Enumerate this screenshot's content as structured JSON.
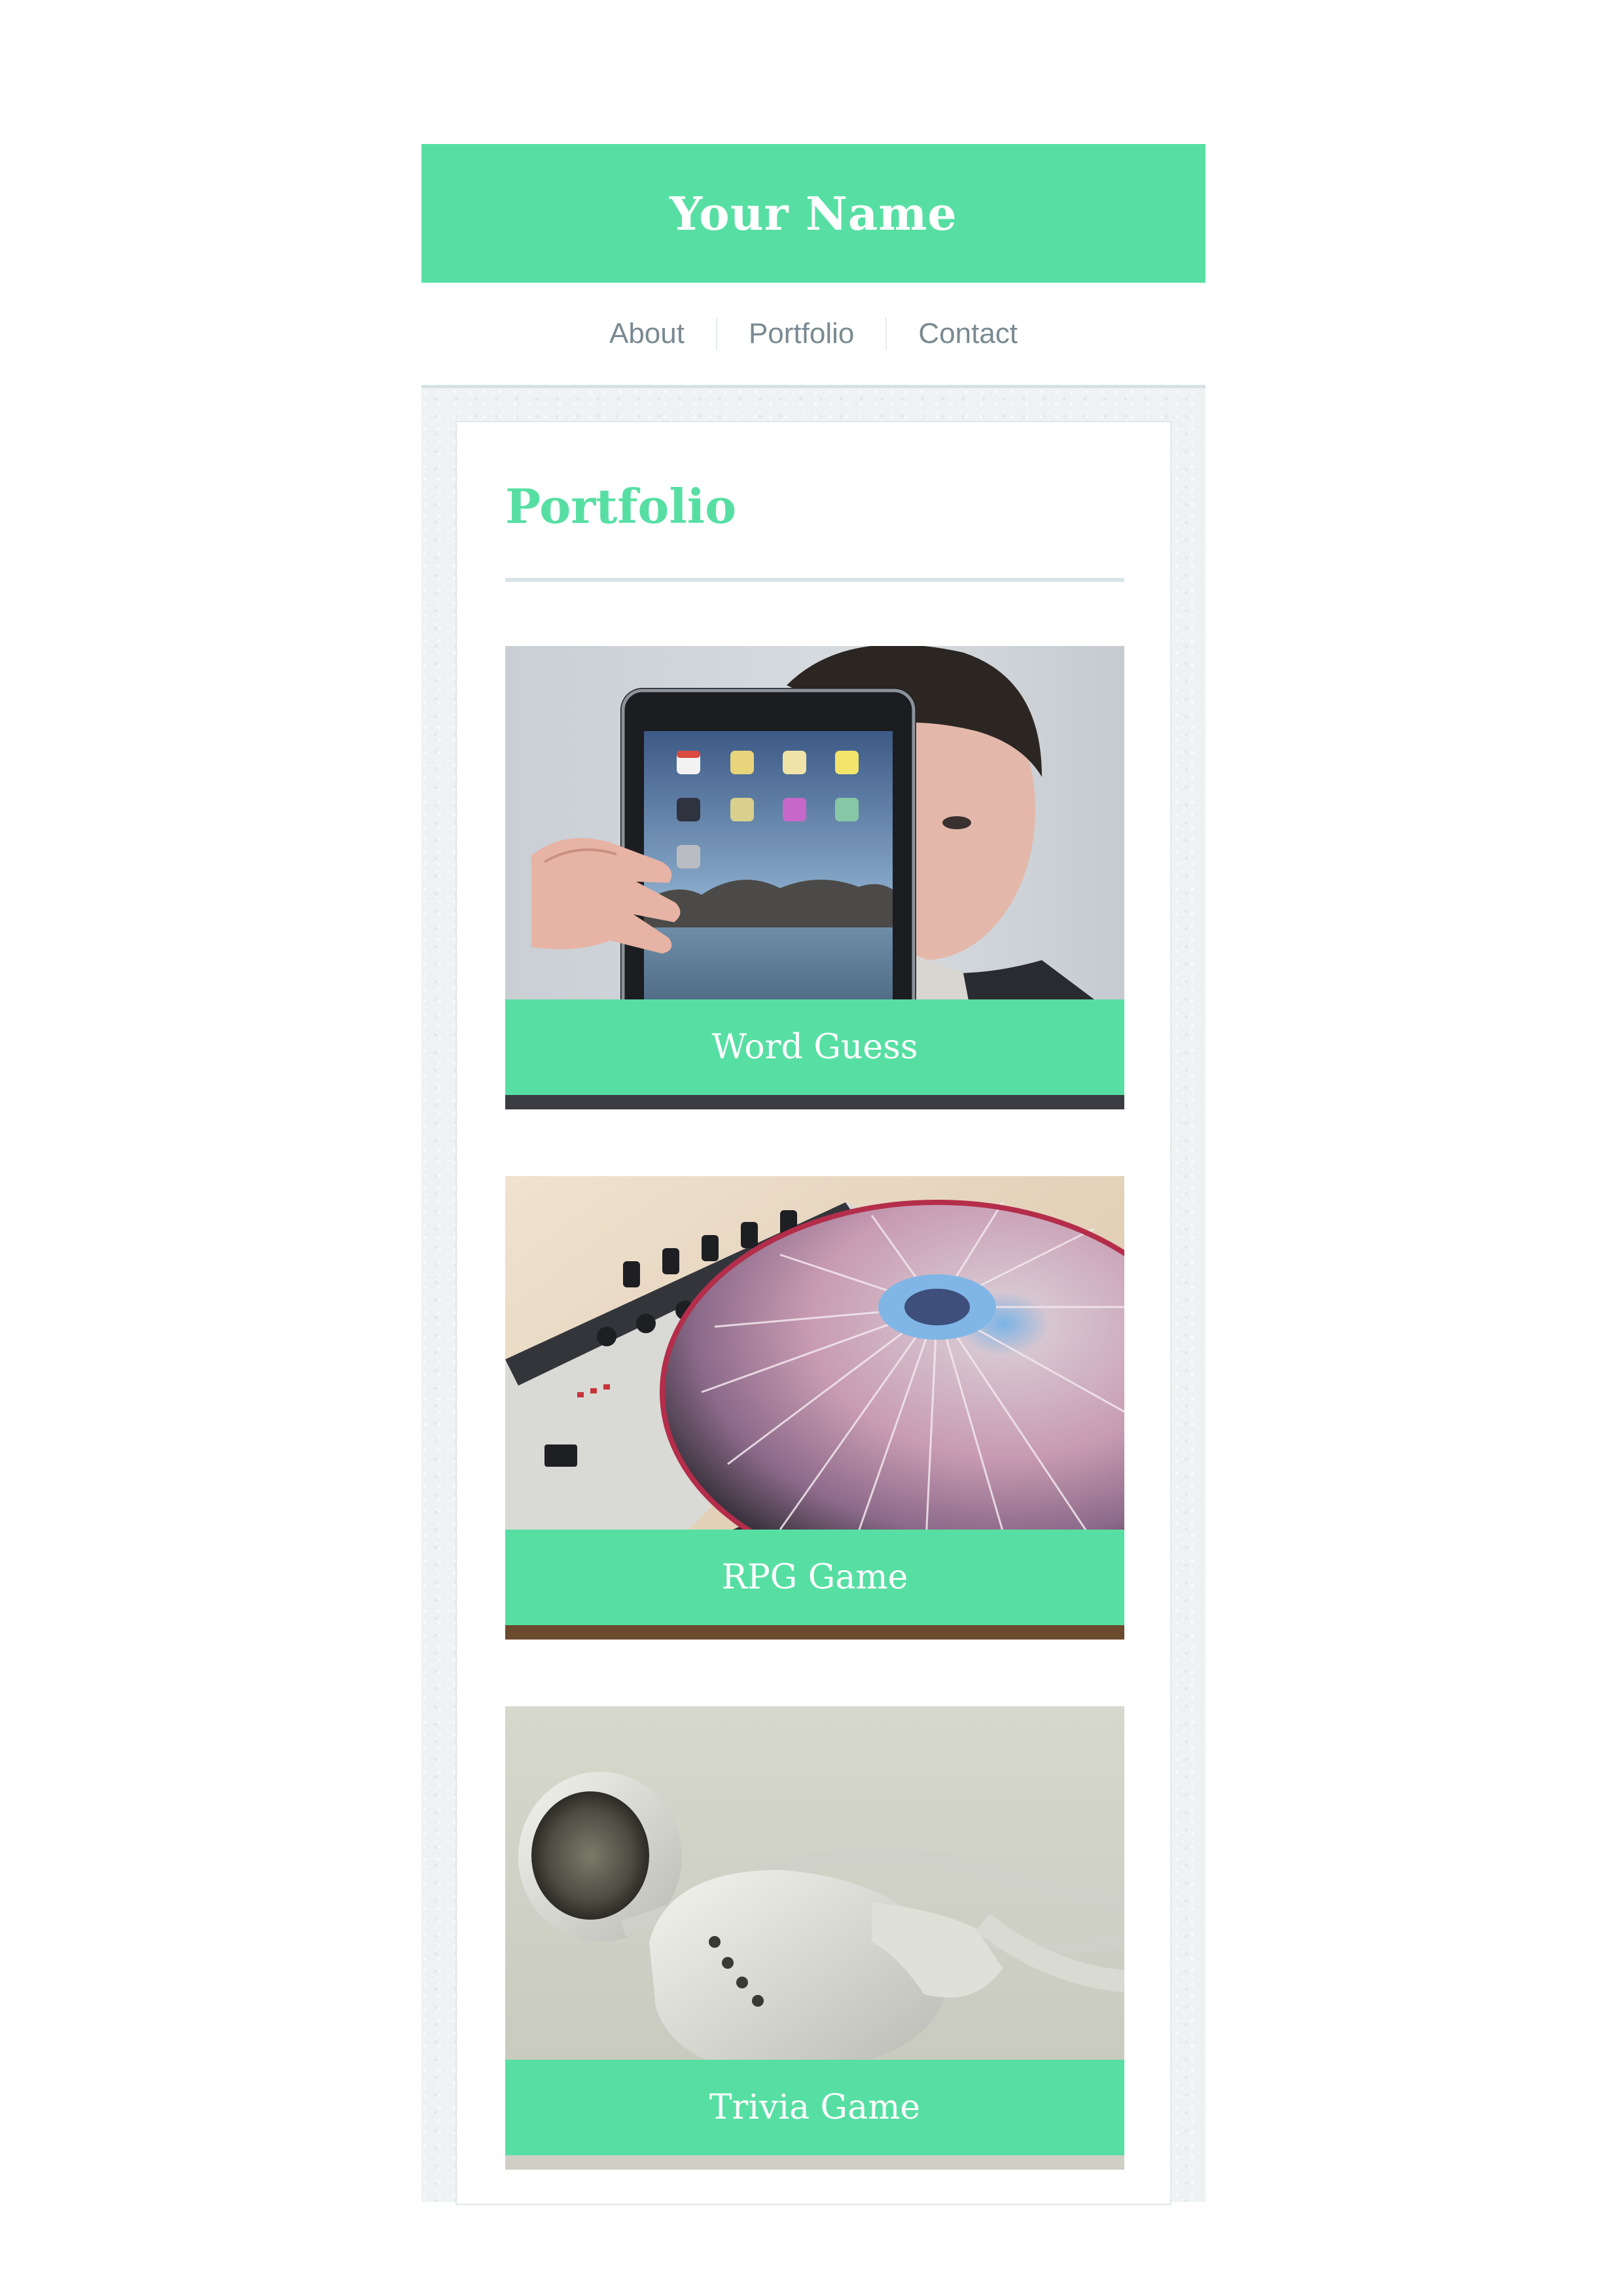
{
  "header": {
    "title": "Your Name"
  },
  "nav": {
    "items": [
      {
        "label": "About"
      },
      {
        "label": "Portfolio"
      },
      {
        "label": "Contact"
      }
    ]
  },
  "main": {
    "section_title": "Portfolio",
    "portfolio_items": [
      {
        "caption": "Word Guess",
        "image": "person-holding-tablet-photo"
      },
      {
        "caption": "RPG Game",
        "image": "dj-turntable-photo"
      },
      {
        "caption": "Trivia Game",
        "image": "white-earbuds-photo"
      }
    ]
  },
  "colors": {
    "accent": "#57dfa3",
    "nav_text": "#7a8a92",
    "content_background": "#eef2f3",
    "rule": "#d9e4e7"
  }
}
